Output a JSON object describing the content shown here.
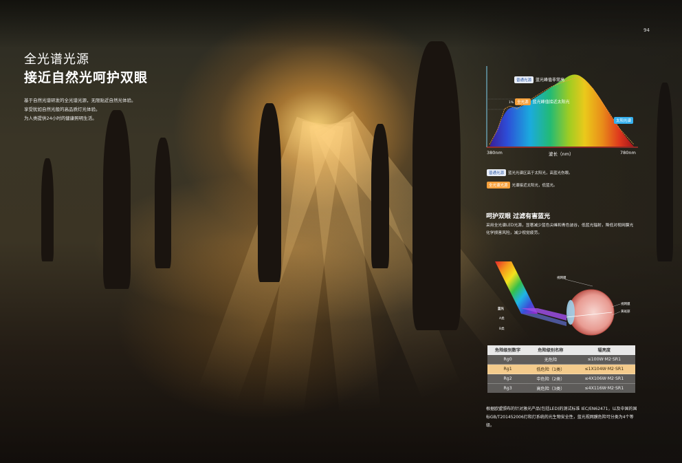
{
  "page": {
    "number": "94",
    "title_line1": "全光谱光源",
    "title_line2": "接近自然光呵护双眼",
    "intro_lines": [
      "基于自然光谱研发的全光谱光源，无限贴近自然光体验。",
      "享受犹如自然光般的高品质灯光体验。",
      "为人类提供24小时的健康照明生活。"
    ]
  },
  "spectrum_chart": {
    "ordinary_tag": "普通光源",
    "ordinary_desc": "蓝光峰值非常高",
    "full_tag": "全光源",
    "full_desc": "蓝光峰值接近太阳光",
    "sun_tag": "太阳光谱",
    "x_start": "380nm",
    "x_mid": "波长（nm）",
    "x_end": "780nm",
    "small_mark": "1%",
    "colors": {
      "ordinary": "#e9eef7",
      "full": "#f6a03b",
      "sun": "#36b0ee"
    }
  },
  "legend": {
    "ordinary_tag": "普通光源",
    "ordinary_text": "蓝光光谱区高于太阳光，高蓝光伤眼。",
    "full_tag": "全光谱光源",
    "full_text": "光谱接近太阳光，低蓝光。"
  },
  "section": {
    "title": "呵护双眼 过滤有害蓝光",
    "text": "采用全光谱LED光源，显著减少蓝色尖峰和青色波谷，低蓝光辐射，降低对视网膜光化学损害风险，减少视觉疲劳。"
  },
  "eye_diagram": {
    "blue_light": "蓝光",
    "label_a": "A类",
    "label_b": "B类",
    "label_retina": "视网膜",
    "label_macula": "视网膜",
    "label_lens": "黄斑部"
  },
  "hazard_table": {
    "headers": [
      "危险级别数字",
      "危险级别名称",
      "辐亮度"
    ],
    "rows": [
      {
        "level": "Rg0",
        "name": "无危险",
        "value": "≤100W·M2·SR1",
        "highlight": false
      },
      {
        "level": "Rg1",
        "name": "低危险（1类）",
        "value": "≤1X104W·M2·SR1",
        "highlight": true
      },
      {
        "level": "Rg2",
        "name": "中危险（2类）",
        "value": "≤4X106W·M2·SR1",
        "highlight": false
      },
      {
        "level": "Rg3",
        "name": "高危险（3类）",
        "value": "≤4X116W·M2·SR1",
        "highlight": false
      }
    ]
  },
  "footnote": "根据欧盟颁布的针对激光产品(包括LED)的测试标准 IEC/EN62471，以及中国的国标GB/T201452006灯和灯系统的光生物安全性，蓝光视网膜危险可分类为4个等级。"
}
